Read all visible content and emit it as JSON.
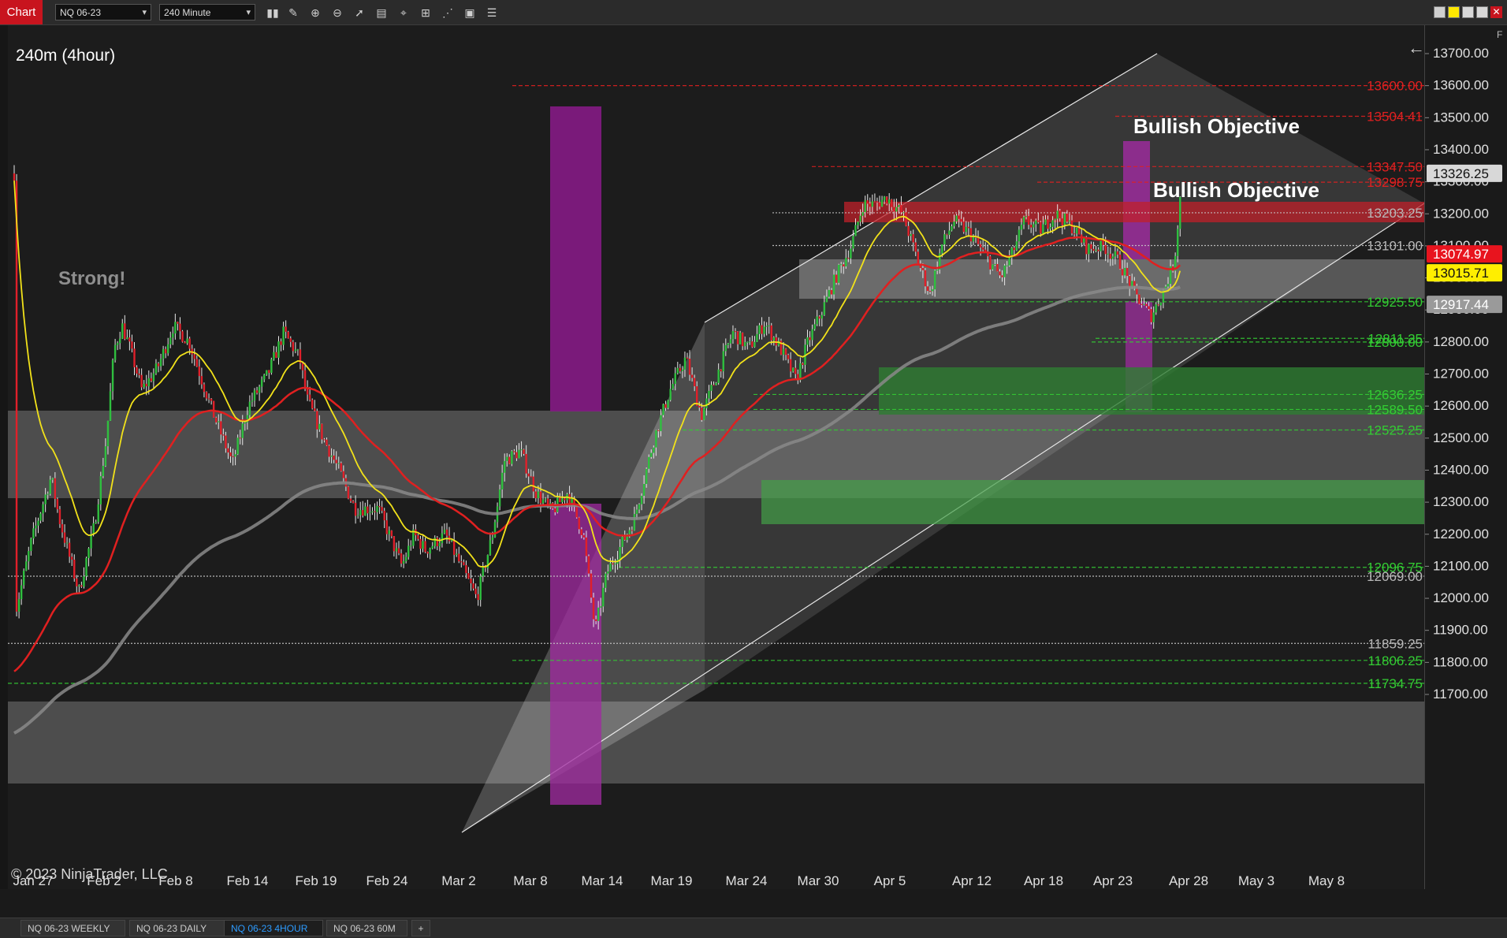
{
  "toolbar": {
    "chart_label": "Chart",
    "instrument": "NQ 06-23",
    "interval": "240 Minute",
    "tools": [
      "bar-chart-icon",
      "pencil-icon",
      "zoom-in-icon",
      "zoom-out-icon",
      "pointer-icon",
      "data-box-icon",
      "crosshair-icon",
      "indicators-icon",
      "strategies-icon",
      "properties-icon",
      "more-icon"
    ]
  },
  "chart": {
    "period_label": "240m (4hour)",
    "copyright": "© 2023 NinjaTrader, LLC",
    "annotations": {
      "strong": "Strong!",
      "bullish_objective_1": "Bullish Objective",
      "bullish_objective_2": "Bullish Objective"
    },
    "price_ticks": [
      "13700.00",
      "13600.00",
      "13500.00",
      "13400.00",
      "13300.00",
      "13200.00",
      "13100.00",
      "13000.00",
      "12900.00",
      "12800.00",
      "12700.00",
      "12600.00",
      "12500.00",
      "12400.00",
      "12300.00",
      "12200.00",
      "12100.00",
      "12000.00",
      "11900.00",
      "11800.00",
      "11700.00"
    ],
    "time_ticks": [
      "Jan 27",
      "Feb 2",
      "Feb 8",
      "Feb 14",
      "Feb 19",
      "Feb 24",
      "Mar 2",
      "Mar 8",
      "Mar 14",
      "Mar 19",
      "Mar 24",
      "Mar 30",
      "Apr 5",
      "Apr 12",
      "Apr 18",
      "Apr 23",
      "Apr 28",
      "May 3",
      "May 8"
    ],
    "level_labels": {
      "r13600": "13600.00",
      "r13504": "13504.41",
      "r13347": "13347.50",
      "r13298": "13298.75",
      "g13203": "13203.25",
      "g13101": "13101.00",
      "gr12925": "12925.50",
      "gr12811": "12811.25",
      "gr12800": "12800.00",
      "gr12636": "12636.25",
      "gr12589": "12589.50",
      "gr12525": "12525.25",
      "gr12096": "12096.75",
      "g12069": "12069.00",
      "g11859": "11859.25",
      "gr11806": "11806.25",
      "gr11734": "11734.75"
    },
    "price_badges": {
      "last": "13326.25",
      "ema_red": "13074.97",
      "ema_yellow": "13015.71",
      "sma_gray": "12917.44"
    },
    "colors": {
      "up_candle": "#2fbf3f",
      "down_candle": "#e0202a",
      "ema_fast": "#f2e21a",
      "ema_mid": "#e02020",
      "sma_slow": "#8a8a8a",
      "zone_purple": "#8b1a8b",
      "zone_green": "#2e7d32",
      "zone_red": "#c0202a"
    }
  },
  "bottom_tabs": {
    "tab1": "NQ 06-23 WEEKLY",
    "tab2": "NQ 06-23 DAILY",
    "tab3": "NQ 06-23 4HOUR",
    "tab4": "NQ 06-23 60M",
    "add": "+"
  }
}
